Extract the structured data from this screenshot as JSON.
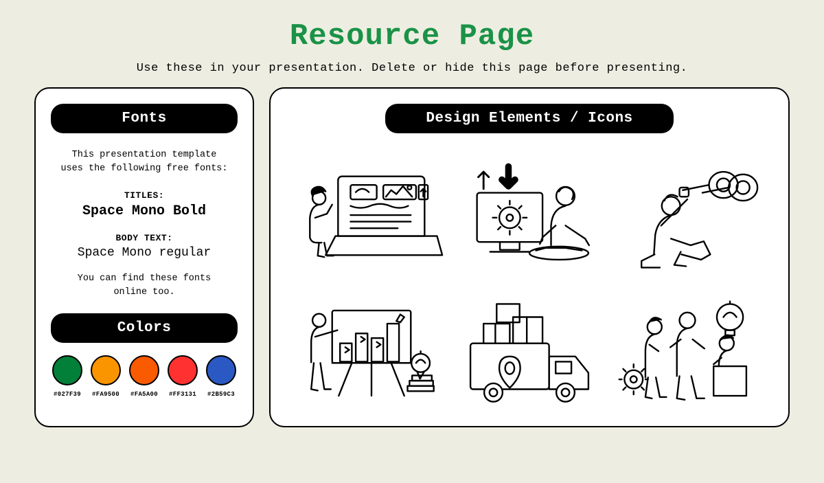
{
  "page": {
    "title": "Resource Page",
    "subtitle": "Use these in your presentation. Delete or hide this page before presenting."
  },
  "left": {
    "fonts_heading": "Fonts",
    "fonts_desc_line1": "This presentation template",
    "fonts_desc_line2": "uses the following free fonts:",
    "titles_label": "TITLES:",
    "title_font": "Space Mono Bold",
    "body_label": "BODY TEXT:",
    "body_font": "Space Mono regular",
    "find_note_line1": "You can find these fonts",
    "find_note_line2": "online too.",
    "colors_heading": "Colors",
    "swatches": [
      {
        "hex": "#027F39"
      },
      {
        "hex": "#FA9500"
      },
      {
        "hex": "#FA5A00"
      },
      {
        "hex": "#FF3131"
      },
      {
        "hex": "#2B59C3"
      }
    ]
  },
  "right": {
    "heading": "Design Elements / Icons",
    "illustrations": [
      "person-presenting-laptop",
      "person-computer-gear-arrows",
      "person-binoculars",
      "person-bar-chart-books",
      "delivery-truck-boxes-pin",
      "team-idea-lightbulb"
    ]
  },
  "colors": {
    "accent_green": "#1a9247",
    "bg": "#edeee1"
  }
}
